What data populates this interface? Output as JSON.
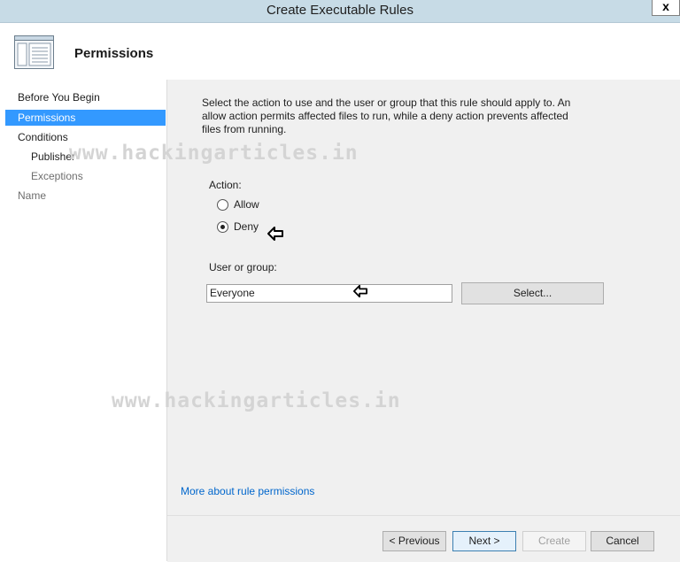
{
  "window": {
    "title": "Create Executable Rules",
    "close_label": "x"
  },
  "header": {
    "title": "Permissions",
    "icon": "wizard-window-icon"
  },
  "nav": {
    "items": [
      {
        "label": "Before You Begin"
      },
      {
        "label": "Permissions"
      },
      {
        "label": "Conditions"
      },
      {
        "label": "Publisher"
      },
      {
        "label": "Exceptions"
      },
      {
        "label": "Name"
      }
    ],
    "selected": "Permissions"
  },
  "main": {
    "description": "Select the action to use and the user or group that this rule should apply to. An allow action permits affected files to run, while a deny action prevents affected files from running.",
    "action_label": "Action:",
    "options": [
      {
        "label": "Allow",
        "selected": false
      },
      {
        "label": "Deny",
        "selected": true
      }
    ],
    "user_group_label": "User or group:",
    "user_group_value": "Everyone",
    "select_button": "Select...",
    "more_link": "More about rule permissions"
  },
  "footer": {
    "previous": "< Previous",
    "next": "Next >",
    "create": "Create",
    "cancel": "Cancel"
  },
  "watermark": "www.hackingarticles.in",
  "colors": {
    "titlebar": "#c7dbe6",
    "nav_selected": "#3399ff",
    "content_bg": "#f0f0f0",
    "link": "#0066cc",
    "disabled_text": "#a0a0a0"
  }
}
